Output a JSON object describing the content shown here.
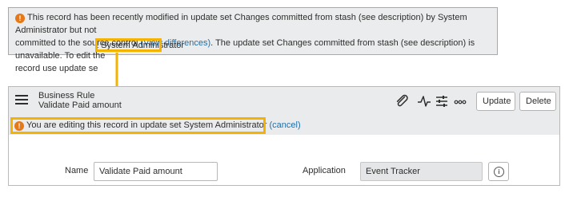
{
  "top_notice": {
    "icon": "warning-icon",
    "line1": "This record has been recently modified in update set Changes committed from stash (see description) by System Administrator but not",
    "line2_pre": "committed to the source control ",
    "line2_link": "(View differences)",
    "line2_post": ". The update set Changes committed from stash (see description) is unavailable. To edit the",
    "line3_pre": "record use update se",
    "line3_highlight": "t System Administrator"
  },
  "form": {
    "record_type": "Business Rule",
    "record_name": "Validate Paid amount",
    "icons": {
      "attachment": "paperclip-icon",
      "activity": "activity-pulse-icon",
      "settings": "sliders-icon",
      "more": "more-options-icon"
    },
    "buttons": {
      "update": "Update",
      "delete": "Delete"
    },
    "edit_notice": {
      "icon": "warning-icon",
      "text": "You are editing this record in update set System Administrator ",
      "cancel": "(cancel)"
    },
    "fields": {
      "name_label": "Name",
      "name_value": "Validate Paid amount",
      "application_label": "Application",
      "application_value": "Event Tracker"
    }
  },
  "colors": {
    "highlight": "#f5b301",
    "warning": "#e67817",
    "link": "#1f6ea7",
    "header_bg": "#eaebec"
  }
}
